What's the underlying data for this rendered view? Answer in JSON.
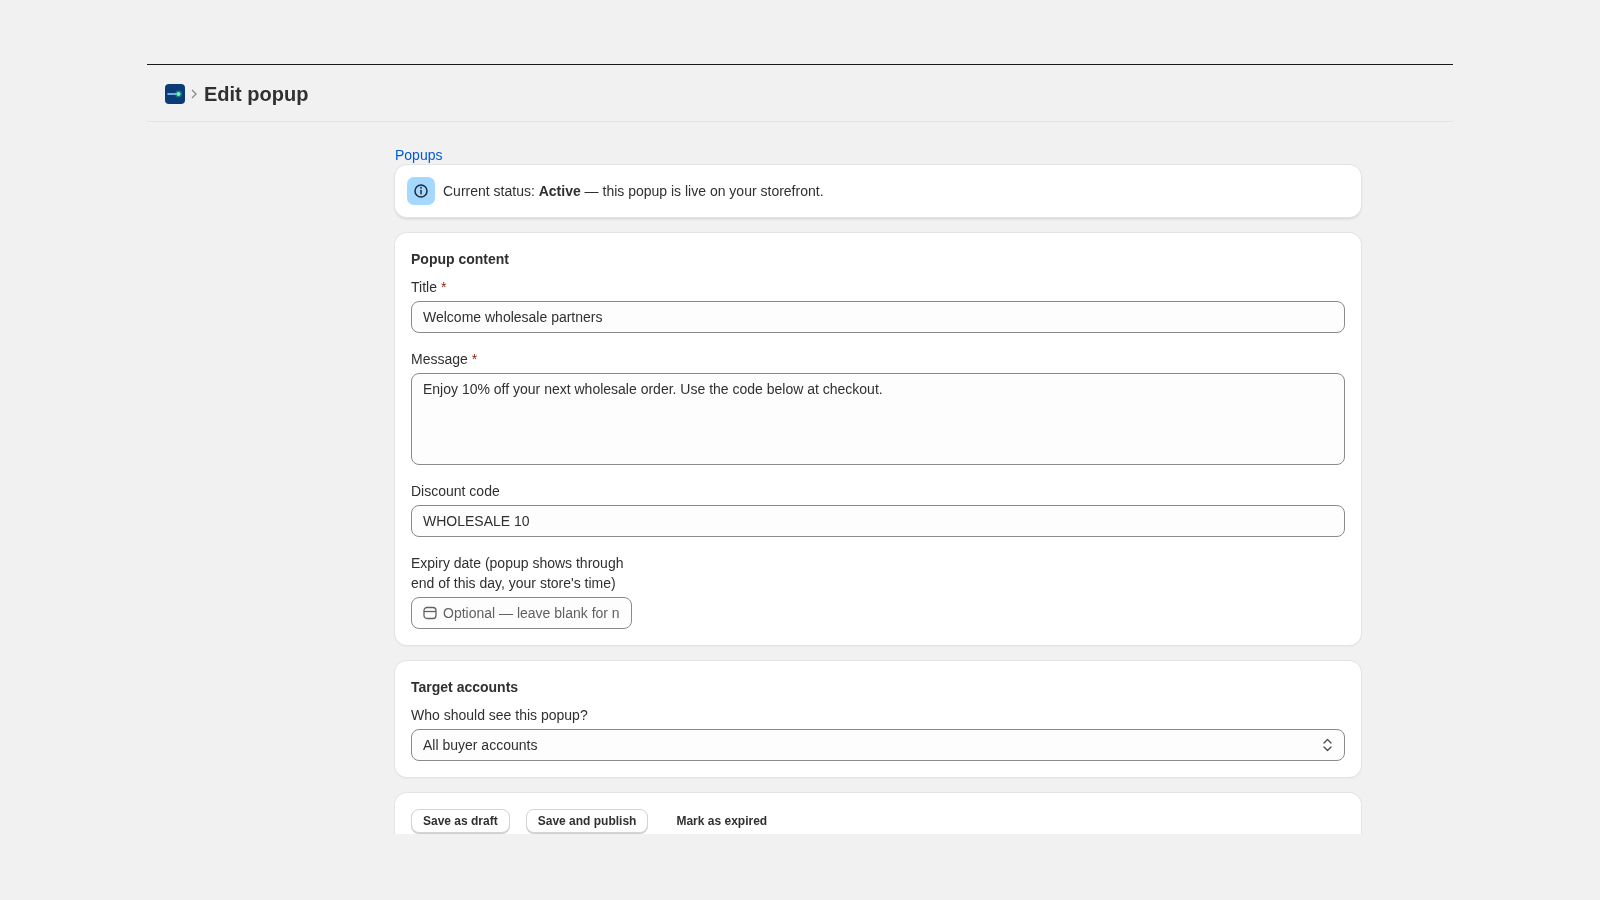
{
  "header": {
    "title": "Edit popup"
  },
  "breadcrumb": {
    "label": "Popups"
  },
  "status_banner": {
    "text": "Current status: **Active** — this popup is live on your storefront."
  },
  "sections": [
    {
      "title": "Popup content",
      "fields": [
        {
          "kind": "text",
          "label": "Title",
          "required_mark": "*",
          "value": "Welcome wholesale partners"
        },
        {
          "kind": "textarea",
          "label": "Message",
          "required_mark": "*",
          "value": "Enjoy 10% off your next wholesale order. Use the code below at checkout."
        },
        {
          "kind": "text",
          "label": "Discount code",
          "value": "WHOLESALE 10"
        },
        {
          "kind": "date",
          "label": "Expiry date (popup shows through end of this day, your store's time)",
          "placeholder": "Optional — leave blank for n"
        }
      ]
    },
    {
      "title": "Target accounts",
      "fields": [
        {
          "kind": "select",
          "label": "Who should see this popup?",
          "value": "All buyer accounts"
        }
      ]
    }
  ],
  "actions": [
    {
      "kind": "secondary",
      "label": "Save as draft"
    },
    {
      "kind": "secondary",
      "label": "Save and publish"
    },
    {
      "kind": "plain",
      "label": "Mark as expired"
    }
  ]
}
